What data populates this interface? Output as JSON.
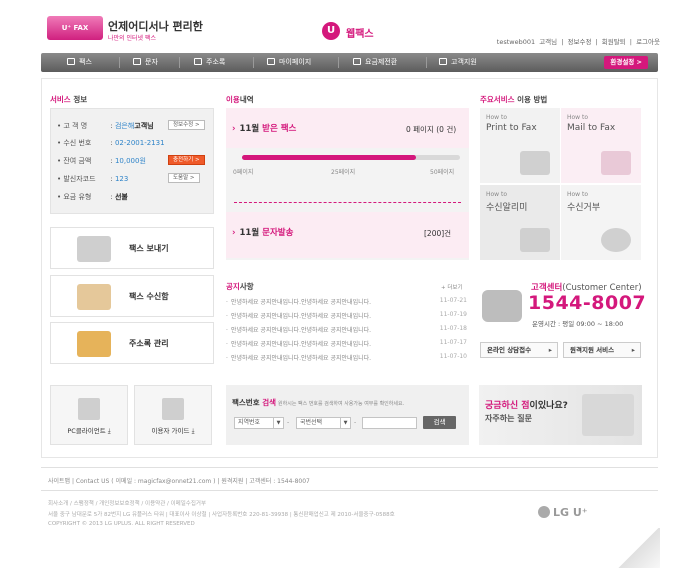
{
  "header": {
    "logo_text": "U⁺ FAX",
    "brand_title": "언제어디서나 편리한",
    "brand_tagline": "나만의 인터넷 팩스",
    "service_name": "웹팩스",
    "user_id": "testweb001",
    "user_suffix": "고객님",
    "links": [
      "로그아웃",
      "회원탈퇴",
      "정보수정"
    ]
  },
  "nav": {
    "items": [
      "팩스",
      "문자",
      "주소록",
      "마이페이지",
      "요금제전환",
      "고객지원"
    ],
    "env_button": "환경설정 >"
  },
  "service_info": {
    "title_pink": "서비스",
    "title_rest": "정보",
    "rows": [
      {
        "label": "고 객 명",
        "value": "검은해"
      },
      {
        "label": "수신 번호",
        "value": "02-2001-2131"
      },
      {
        "label": "잔여 금액",
        "value": "10,000원"
      },
      {
        "label": "발신자코드",
        "value": "123"
      },
      {
        "label": "요금 유형",
        "value": "선불"
      }
    ],
    "customer_suffix": "고객님",
    "info_change_btn": "정보수정 >",
    "charge_btn": "충전하기 >",
    "guide_btn": "도움말 >"
  },
  "side_cards": [
    "팩스 보내기",
    "팩스 수신함",
    "주소록 관리"
  ],
  "tools": [
    "PC클라이언트",
    "이용자 가이드"
  ],
  "usage": {
    "title_pink": "이용",
    "title_rest": "내역",
    "received_label_month": "11월",
    "received_label": "받은 팩스",
    "received_value": "0 페이지 (0 건)",
    "bar_fill_percent": 80,
    "bar_labels": [
      "0페이지",
      "25페이지",
      "50페이지"
    ],
    "sms_label_month": "11월",
    "sms_label": "문자발송",
    "sms_value": "[200]건"
  },
  "how_to": {
    "title_pink": "주요서비스",
    "title_rest": "이용 방법",
    "cards": [
      {
        "t1": "How to",
        "t2": "Print to Fax"
      },
      {
        "t1": "How to",
        "t2": "Mail to Fax"
      },
      {
        "t1": "How to",
        "t2": "수신알리미"
      },
      {
        "t1": "How to",
        "t2": "수신거부"
      }
    ]
  },
  "notice": {
    "title_pink": "공지",
    "title_rest": "사항",
    "more": "+ 더보기",
    "items": [
      {
        "text": "안녕하세요 공지안내입니다.안녕하세요 공지안내입니다.",
        "date": "11-07-21"
      },
      {
        "text": "안녕하세요 공지안내입니다.안녕하세요 공지안내입니다.",
        "date": "11-07-19"
      },
      {
        "text": "안녕하세요 공지안내입니다.안녕하세요 공지안내입니다.",
        "date": "11-07-18"
      },
      {
        "text": "안녕하세요 공지안내입니다.안녕하세요 공지안내입니다.",
        "date": "11-07-17"
      },
      {
        "text": "안녕하세요 공지안내입니다.안녕하세요 공지안내입니다.",
        "date": "11-07-10"
      }
    ]
  },
  "customer_center": {
    "title": "고객센터",
    "title_en": "(Customer Center)",
    "phone": "1544-8007",
    "hours": "운영시간 : 평일 09:00 ~ 18:00",
    "btn_consult": "온라인 상담접수",
    "btn_remote": "원격지원 서비스"
  },
  "fax_search": {
    "title_rest": "팩스번호",
    "title_pink": "검색",
    "desc": "원하시는 팩스 번호를 검색하여 사용가능 여부를 확인하세요.",
    "select_region": "지역번호",
    "select_office": "국번선택",
    "button": "검색"
  },
  "faq": {
    "line1_pink": "궁금하신 점",
    "line1_rest": "이있나요?",
    "line2": "자주하는 질문"
  },
  "footer": {
    "links": "사이트맵 | Contact US ( 이메일 : magicfax@onnet21.com ) | 원격지원 | 고객센터 : 1544-8007",
    "policy": "회사소개 / 스팸정책 / 개인정보보호정책 / 이용약관 / 이메일수집거부",
    "address": "서울 중구 남대문로 5가 82번지 LG 유플러스 타워 | 대표이사 이상철 | 사업자등록번호 220-81-39938 | 통신판매업신고 제 2010-서울중구-0588호",
    "copyright": "COPYRIGHT © 2013 LG UPLUS. ALL RIGHT RESERVED",
    "lg_logo": "LG U⁺"
  },
  "colors": {
    "accent": "#d4187c",
    "nav": "#6e6e6e"
  }
}
